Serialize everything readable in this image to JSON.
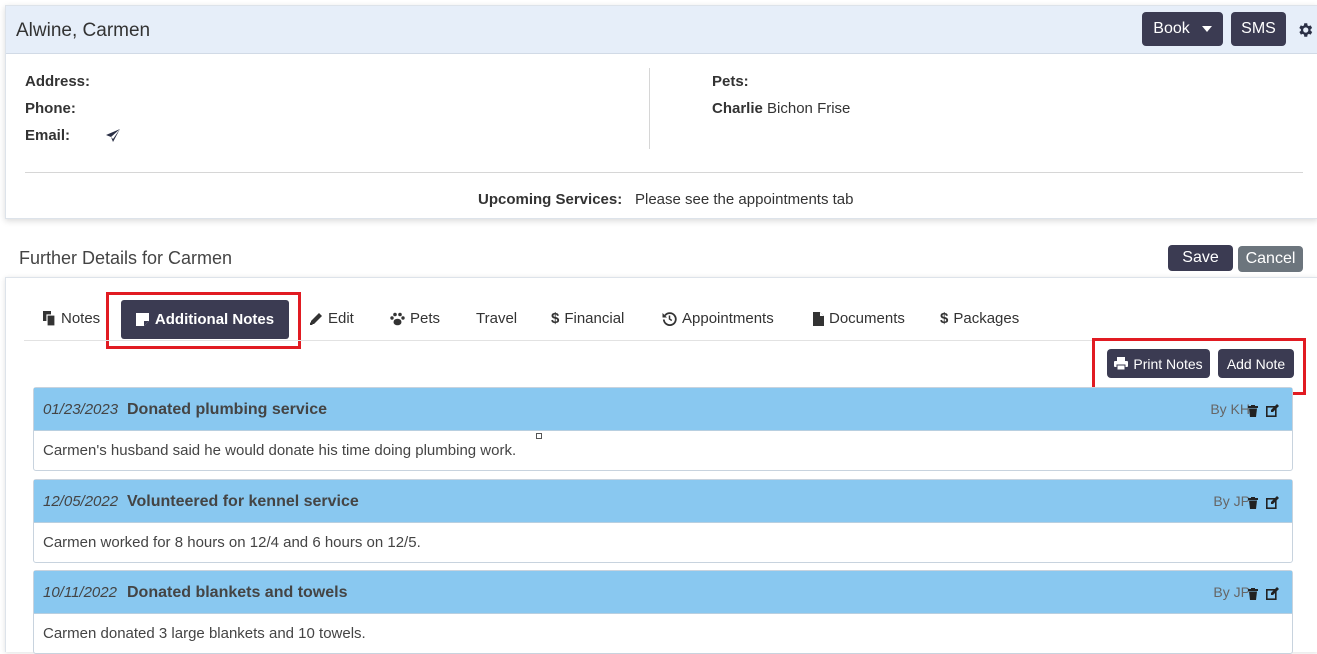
{
  "client": {
    "name": "Alwine, Carmen"
  },
  "header_buttons": {
    "book": "Book",
    "sms": "SMS"
  },
  "contact": {
    "address_label": "Address:",
    "phone_label": "Phone:",
    "email_label": "Email:"
  },
  "pets": {
    "label": "Pets:",
    "name": "Charlie",
    "breed": "Bichon Frise"
  },
  "upcoming": {
    "label": "Upcoming Services:",
    "value": "Please see the appointments tab"
  },
  "further": {
    "title": "Further Details for Carmen",
    "save": "Save",
    "cancel": "Cancel"
  },
  "tabs": [
    {
      "label": "Notes",
      "icon": "copy-icon"
    },
    {
      "label": "Additional Notes",
      "icon": "sticky-note-icon",
      "active": true
    },
    {
      "label": "Edit",
      "icon": "pencil-icon"
    },
    {
      "label": "Pets",
      "icon": "paw-icon"
    },
    {
      "label": "Travel",
      "icon": ""
    },
    {
      "label": "Financial",
      "icon": "dollar-icon"
    },
    {
      "label": "Appointments",
      "icon": "history-icon"
    },
    {
      "label": "Documents",
      "icon": "file-icon"
    },
    {
      "label": "Packages",
      "icon": "dollar-icon"
    }
  ],
  "actions": {
    "print_notes": "Print Notes",
    "add_note": "Add Note"
  },
  "notes": [
    {
      "date": "01/23/2023",
      "title": "Donated plumbing service",
      "by": "By KH",
      "body": "Carmen's husband said he would donate his time doing plumbing work."
    },
    {
      "date": "12/05/2022",
      "title": "Volunteered for kennel service",
      "by": "By JP",
      "body": "Carmen worked for 8 hours on 12/4 and 6 hours on 12/5."
    },
    {
      "date": "10/11/2022",
      "title": "Donated blankets and towels",
      "by": "By JP",
      "body": "Carmen donated 3 large blankets and 10 towels."
    }
  ],
  "colors": {
    "dark_button": "#3b3b52",
    "note_header": "#89c8f0",
    "highlight": "#e11b22",
    "header_bg": "#e6eef9"
  }
}
